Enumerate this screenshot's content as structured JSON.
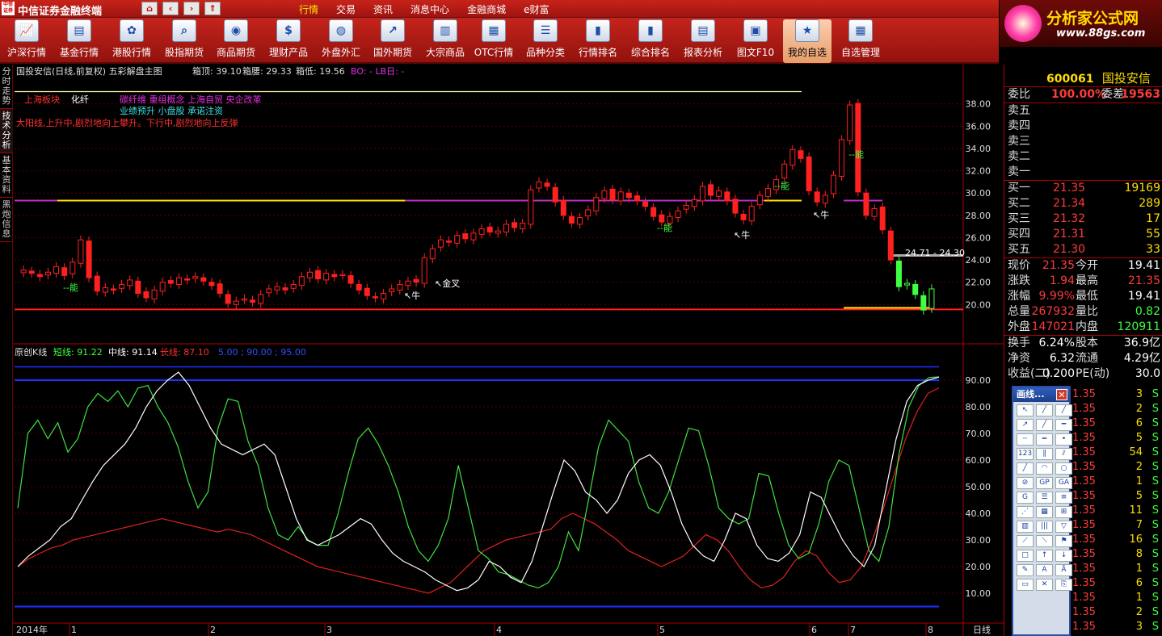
{
  "app": {
    "title": "中信证券金融终端",
    "logo": "中信证券"
  },
  "nav_buttons": [
    "home-icon",
    "back-icon",
    "forward-icon",
    "up-icon"
  ],
  "menu": [
    "行情",
    "交易",
    "资讯",
    "消息中心",
    "金融商城",
    "e财富"
  ],
  "brand": {
    "name": "分析家公式网",
    "url": "www.88gs.com"
  },
  "toolbar": [
    {
      "label": "沪深行情",
      "icon": "chart-icon"
    },
    {
      "label": "基金行情",
      "icon": "fund-icon"
    },
    {
      "label": "港股行情",
      "icon": "hk-icon"
    },
    {
      "label": "股指期货",
      "icon": "magnify-icon"
    },
    {
      "label": "商品期货",
      "icon": "coins-icon"
    },
    {
      "label": "理财产品",
      "icon": "dollar-icon"
    },
    {
      "label": "外盘外汇",
      "icon": "globe-icon"
    },
    {
      "label": "国外期货",
      "icon": "chart-up-icon"
    },
    {
      "label": "大宗商品",
      "icon": "stack-icon"
    },
    {
      "label": "OTC行情",
      "icon": "table-icon"
    },
    {
      "label": "品种分类",
      "icon": "list-icon"
    },
    {
      "label": "行情排名",
      "icon": "bars-icon"
    },
    {
      "label": "综合排名",
      "icon": "bars2-icon"
    },
    {
      "label": "报表分析",
      "icon": "report-icon"
    },
    {
      "label": "图文F10",
      "icon": "doc-icon"
    },
    {
      "label": "我的自选",
      "icon": "star-hand-icon",
      "active": true
    },
    {
      "label": "自选管理",
      "icon": "manage-icon"
    }
  ],
  "side_tabs": [
    "分时走势",
    "技术分析",
    "基本资料",
    "黑炮信息"
  ],
  "main_chart": {
    "header_name": "国投安信(日线,前复权) 五彩解盘主图",
    "box_top": "箱顶: 39.10",
    "box_waist": "箱腰: 29.33",
    "box_bottom": "箱低: 19.56",
    "bo_lb": "BO: - LB日: -",
    "sector_label": "上海板块",
    "industry": "化纤",
    "concepts1": "碳纤维 重组概念 上海自贸 央企改革",
    "concepts2": "业绩预升 小盘股 承诺注资",
    "hint": "大阳线,上升中,剧烈地向上攀升。下行中,剧烈地向上反弹",
    "range_label": "24.71 - 24.30",
    "annotations": [
      "--能",
      "↖牛",
      "↖金叉",
      "--能",
      "↖牛",
      "--能",
      "↖牛",
      "--能"
    ]
  },
  "sub_chart": {
    "name": "原创K线",
    "short": "短线: 91.22",
    "mid": "中线: 91.14",
    "long": "长线: 87.10",
    "levels": "5.00 ; 90.00 ; 95.00"
  },
  "x_axis": {
    "labels": [
      "2014年",
      "1",
      "2",
      "3",
      "4",
      "5",
      "6",
      "7",
      "8"
    ],
    "period": "日线"
  },
  "chart_data": {
    "type": "line",
    "price_axis": [
      "38.00",
      "36.00",
      "34.00",
      "32.00",
      "30.00",
      "28.00",
      "26.00",
      "24.00",
      "22.00",
      "20.00"
    ],
    "price_ylim": [
      18.5,
      39.5
    ],
    "ind_axis": [
      "90.00",
      "80.00",
      "70.00",
      "60.00",
      "50.00",
      "40.00",
      "30.00",
      "20.00",
      "10.00"
    ],
    "ind_ylim": [
      0,
      100
    ],
    "candles_close": [
      23.1,
      22.8,
      22.5,
      22.9,
      23.4,
      22.6,
      23.8,
      25.8,
      22.4,
      21.2,
      21.5,
      21.3,
      21.8,
      22.2,
      21.0,
      20.6,
      21.3,
      22.0,
      21.9,
      22.4,
      22.2,
      22.5,
      22.1,
      21.7,
      21.0,
      20.1,
      20.3,
      20.5,
      20.2,
      20.9,
      21.4,
      21.6,
      21.3,
      21.8,
      22.5,
      22.9,
      22.3,
      22.8,
      22.5,
      22.7,
      21.9,
      21.3,
      20.8,
      20.6,
      21.0,
      21.4,
      21.8,
      22.1,
      22.0,
      24.2,
      25.0,
      25.8,
      25.6,
      26.2,
      25.9,
      26.4,
      26.8,
      26.5,
      26.6,
      27.2,
      26.9,
      27.3,
      30.3,
      31.0,
      30.6,
      29.2,
      28.0,
      27.3,
      27.8,
      28.5,
      29.6,
      30.2,
      29.4,
      30.1,
      29.6,
      29.3,
      28.8,
      27.9,
      27.4,
      27.9,
      28.4,
      28.9,
      29.4,
      30.6,
      29.8,
      30.2,
      29.3,
      28.2,
      27.6,
      28.8,
      29.8,
      30.4,
      31.2,
      32.6,
      33.9,
      33.1,
      30.2,
      29.2,
      29.8,
      31.6,
      34.8,
      37.9,
      30.1,
      28.0,
      28.6,
      26.7,
      24.0,
      21.6,
      21.9,
      20.9,
      19.5,
      21.4
    ],
    "ind_short": [
      42,
      70,
      75,
      68,
      74,
      63,
      68,
      80,
      85,
      82,
      86,
      80,
      87,
      88,
      80,
      74,
      65,
      52,
      42,
      48,
      72,
      83,
      82,
      67,
      58,
      42,
      32,
      30,
      35,
      30,
      28,
      28,
      40,
      55,
      68,
      72,
      66,
      58,
      48,
      35,
      26,
      22,
      28,
      38,
      58,
      42,
      26,
      23,
      18,
      17,
      15,
      13,
      12,
      14,
      20,
      33,
      26,
      45,
      65,
      75,
      71,
      67,
      52,
      42,
      40,
      48,
      60,
      72,
      71,
      58,
      42,
      38,
      36,
      38,
      55,
      54,
      40,
      28,
      23,
      25,
      36,
      52,
      60,
      58,
      42,
      26,
      22,
      35,
      62,
      80,
      88,
      91,
      91.22
    ],
    "ind_mid": [
      20,
      24,
      27,
      30,
      35,
      38,
      45,
      52,
      58,
      62,
      66,
      72,
      80,
      86,
      90,
      93,
      88,
      80,
      72,
      66,
      64,
      62,
      64,
      66,
      62,
      50,
      38,
      30,
      28,
      30,
      32,
      35,
      38,
      36,
      30,
      25,
      22,
      20,
      18,
      15,
      13,
      11,
      12,
      15,
      22,
      20,
      16,
      14,
      22,
      35,
      48,
      60,
      56,
      48,
      45,
      40,
      45,
      55,
      60,
      62,
      58,
      48,
      36,
      28,
      24,
      22,
      30,
      40,
      38,
      28,
      23,
      22,
      25,
      32,
      48,
      46,
      38,
      30,
      24,
      20,
      28,
      48,
      68,
      82,
      88,
      90,
      91.14
    ],
    "ind_long": [
      20,
      23,
      25,
      27,
      28,
      30,
      31,
      32,
      33,
      34,
      35,
      36,
      37,
      38,
      37,
      36,
      35,
      34,
      33,
      34,
      33,
      32,
      30,
      28,
      26,
      24,
      22,
      20,
      19,
      18,
      17,
      16,
      15,
      14,
      13,
      12,
      11,
      10,
      12,
      14,
      18,
      22,
      26,
      28,
      30,
      31,
      32,
      33,
      34,
      38,
      40,
      38,
      36,
      33,
      30,
      26,
      24,
      22,
      20,
      22,
      24,
      28,
      32,
      30,
      26,
      20,
      15,
      12,
      13,
      16,
      22,
      26,
      24,
      18,
      14,
      15,
      20,
      30,
      42,
      55,
      68,
      78,
      85,
      87.1
    ]
  },
  "quote": {
    "code": "600061",
    "name": "国投安信",
    "weibi_label": "委比",
    "weibi": "100.00%",
    "weicha_label": "委差",
    "weicha": "19563",
    "sells": [
      "卖五",
      "卖四",
      "卖三",
      "卖二",
      "卖一"
    ],
    "buys": [
      {
        "label": "买一",
        "price": "21.35",
        "vol": "19169"
      },
      {
        "label": "买二",
        "price": "21.34",
        "vol": "289"
      },
      {
        "label": "买三",
        "price": "21.32",
        "vol": "17"
      },
      {
        "label": "买四",
        "price": "21.31",
        "vol": "55"
      },
      {
        "label": "买五",
        "price": "21.30",
        "vol": "33"
      }
    ],
    "stats": [
      {
        "l1": "现价",
        "v1": "21.35",
        "l2": "今开",
        "v2": "19.41"
      },
      {
        "l1": "涨跌",
        "v1": "1.94",
        "l2": "最高",
        "v2": "21.35"
      },
      {
        "l1": "涨幅",
        "v1": "9.99%",
        "l2": "最低",
        "v2": "19.41"
      },
      {
        "l1": "总量",
        "v1": "267932",
        "l2": "量比",
        "v2": "0.82"
      },
      {
        "l1": "外盘",
        "v1": "147021",
        "l2": "内盘",
        "v2": "120911"
      }
    ],
    "stats2": [
      {
        "l1": "换手",
        "v1": "6.24%",
        "l2": "股本",
        "v2": "36.9亿"
      },
      {
        "l1": "净资",
        "v1": "6.32",
        "l2": "流通",
        "v2": "4.29亿"
      },
      {
        "l1": "收益(二)",
        "v1": "0.200",
        "l2": "PE(动)",
        "v2": "30.0"
      }
    ],
    "ticks": [
      {
        "p": "1.35",
        "v": "3",
        "s": "S"
      },
      {
        "p": "1.35",
        "v": "2",
        "s": "S"
      },
      {
        "p": "1.35",
        "v": "6",
        "s": "S"
      },
      {
        "p": "1.35",
        "v": "5",
        "s": "S"
      },
      {
        "p": "1.35",
        "v": "54",
        "s": "S"
      },
      {
        "p": "1.35",
        "v": "2",
        "s": "S"
      },
      {
        "p": "1.35",
        "v": "1",
        "s": "S"
      },
      {
        "p": "1.35",
        "v": "5",
        "s": "S"
      },
      {
        "p": "1.35",
        "v": "11",
        "s": "S"
      },
      {
        "p": "1.35",
        "v": "7",
        "s": "S"
      },
      {
        "p": "1.35",
        "v": "16",
        "s": "S"
      },
      {
        "p": "1.35",
        "v": "8",
        "s": "S"
      },
      {
        "p": "1.35",
        "v": "1",
        "s": "S"
      },
      {
        "p": "1.35",
        "v": "6",
        "s": "S"
      },
      {
        "p": "1.35",
        "v": "1",
        "s": "S"
      },
      {
        "p": "1.35",
        "v": "2",
        "s": "S"
      },
      {
        "p": "1.35",
        "v": "3",
        "s": "S"
      }
    ]
  },
  "draw_toolbox": {
    "title": "画线...",
    "tools": [
      "select-icon",
      "line-icon",
      "ray-icon",
      "arrow-line-icon",
      "segment-icon",
      "hline-icon",
      "dash-line-icon",
      "double-line-icon",
      "point-line-icon",
      "fib-123-icon",
      "parallel-icon",
      "channel-icon",
      "slash-icon",
      "arc-icon",
      "circle-icon",
      "gann-icon",
      "gp-icon",
      "ga-icon",
      "g-icon",
      "levels-icon",
      "fib-icon",
      "fan-icon",
      "grid-icon",
      "cycle-icon",
      "bars-vert-icon",
      "time-icon",
      "triangle-icon",
      "speed-icon",
      "fan2-icon",
      "flag-icon",
      "rect-icon",
      "up-arrow-icon",
      "down-arrow-icon",
      "pen-icon",
      "text-icon",
      "text-a-icon",
      "eraser-icon",
      "delete-icon",
      "stamp-icon"
    ]
  }
}
